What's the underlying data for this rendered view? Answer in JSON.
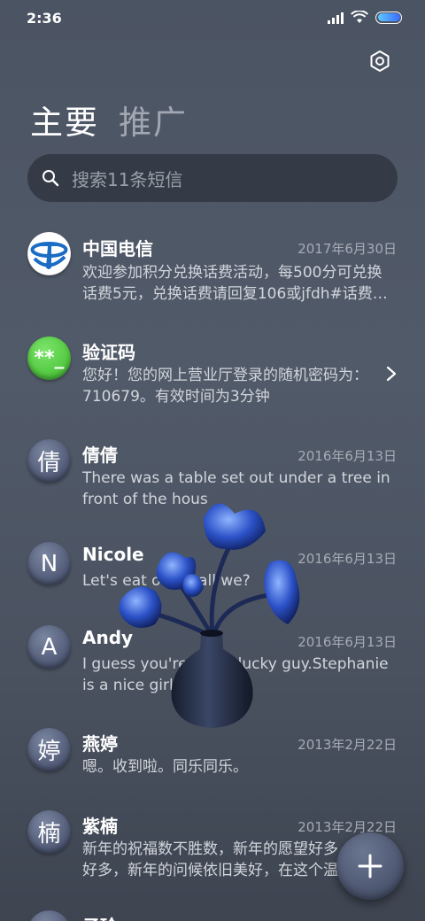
{
  "status_bar": {
    "time": "2:36"
  },
  "tabs": [
    {
      "label": "主要"
    },
    {
      "label": "推广"
    }
  ],
  "search": {
    "placeholder": "搜索11条短信"
  },
  "conversations": [
    {
      "avatar": "telecom-logo",
      "name": "中国电信",
      "date": "2017年6月30日",
      "preview": "欢迎参加积分兑换话费活动，每500分可兑换话费5元，兑换话费请回复106或jfdh#话费…"
    },
    {
      "avatar": "**_",
      "name": "验证码",
      "date": "",
      "preview": "您好！您的网上营业厅登录的随机密码为：710679。有效时间为3分钟"
    },
    {
      "avatar": "倩",
      "name": "倩倩",
      "date": "2016年6月13日",
      "preview": "There was a table set out under a tree in front of the hous"
    },
    {
      "avatar": "N",
      "name": "Nicole",
      "date": "2016年6月13日",
      "preview": "Let's eat out,shall we?"
    },
    {
      "avatar": "A",
      "name": "Andy",
      "date": "2016年6月13日",
      "preview": "I guess you're some lucky guy.Stephanie is a nice girl."
    },
    {
      "avatar": "婷",
      "name": "燕婷",
      "date": "2013年2月22日",
      "preview": "嗯。收到啦。同乐同乐。"
    },
    {
      "avatar": "楠",
      "name": "紫楠",
      "date": "2013年2月22日",
      "preview": "新年的祝福数不胜数，新年的愿望好多好多，新年的问候依旧美好，在这个温馨的日子"
    },
    {
      "avatar": "",
      "name": "子玲",
      "date": "",
      "preview": ""
    }
  ],
  "colors": {
    "background": "#4b5463",
    "search_bg": "#353b46",
    "avatar_green": "#4cc53a",
    "telecom_blue": "#1b6cc4"
  }
}
